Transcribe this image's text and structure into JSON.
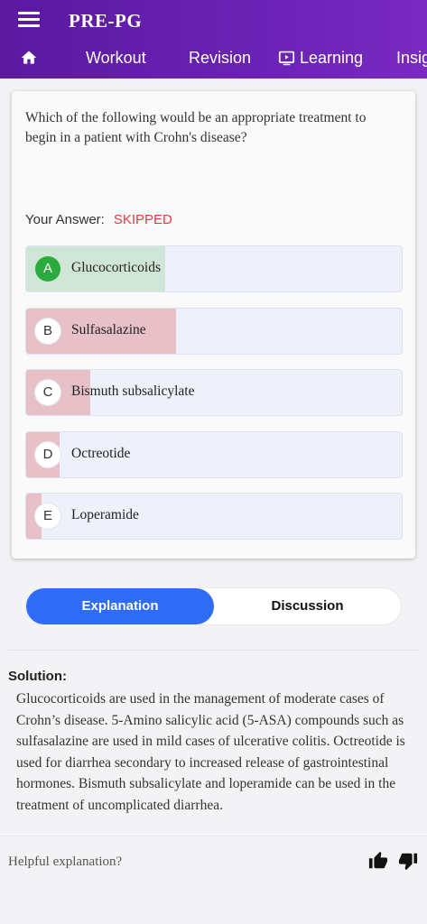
{
  "header": {
    "title": "PRE-PG",
    "nav": {
      "home_icon": "home-icon",
      "workout": "Workout",
      "revision": "Revision",
      "learning": "Learning",
      "learning_icon": "play-screen-icon",
      "insights": "Insig"
    },
    "colors": {
      "gradient_start": "#5a1aa0",
      "gradient_end": "#7a2ac0"
    }
  },
  "question": {
    "text": "Which of the following would be an appropriate treatment to begin in a patient with Crohn's disease?",
    "answer_label": "Your Answer:",
    "answer_value": "SKIPPED",
    "options": [
      {
        "letter": "A",
        "text": "Glucocorticoids",
        "correct": true,
        "response_share": 0.37
      },
      {
        "letter": "B",
        "text": "Sulfasalazine",
        "correct": false,
        "response_share": 0.4
      },
      {
        "letter": "C",
        "text": "Bismuth subsalicylate",
        "correct": false,
        "response_share": 0.17
      },
      {
        "letter": "D",
        "text": "Octreotide",
        "correct": false,
        "response_share": 0.09
      },
      {
        "letter": "E",
        "text": "Loperamide",
        "correct": false,
        "response_share": 0.04
      }
    ],
    "colors": {
      "correct_fill": "#cfe6d6",
      "other_fill": "#e8c0c8",
      "correct_badge": "#2bab3e",
      "skipped": "#e03a45"
    }
  },
  "tabs": {
    "explanation": "Explanation",
    "discussion": "Discussion",
    "active": "explanation",
    "active_color": "#2f6cf6"
  },
  "solution": {
    "title": "Solution:",
    "text": "Glucocorticoids are used in the management of moderate cases of Crohn’s disease. 5-Amino salicylic acid (5-ASA) compounds such as sulfasalazine are used in mild cases of ulcerative colitis. Octreotide is used for diarrhea secondary to increased release of gastrointestinal hormones. Bismuth subsalicylate and loperamide can be used in the treatment of uncomplicated diarrhea."
  },
  "feedback": {
    "prompt": "Helpful explanation?",
    "up_icon": "thumbs-up-icon",
    "down_icon": "thumbs-down-icon"
  }
}
